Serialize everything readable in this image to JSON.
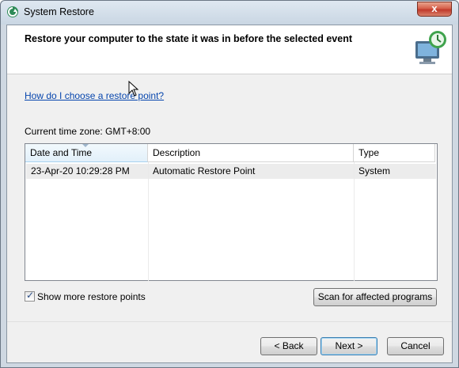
{
  "window": {
    "title": "System Restore",
    "close_symbol": "x"
  },
  "header": {
    "title": "Restore your computer to the state it was in before the selected event"
  },
  "help_link": "How do I choose a restore point?",
  "timezone_label": "Current time zone: GMT+8:00",
  "table": {
    "columns": [
      "Date and Time",
      "Description",
      "Type"
    ],
    "rows": [
      {
        "date": "23-Apr-20 10:29:28 PM",
        "description": "Automatic Restore Point",
        "type": "System"
      }
    ]
  },
  "show_more": {
    "label": "Show more restore points",
    "checked": true
  },
  "buttons": {
    "scan": "Scan for affected programs",
    "back": "< Back",
    "next": "Next >",
    "cancel": "Cancel"
  },
  "colors": {
    "link": "#0645ad",
    "close_button": "#c0392b",
    "selected_row": "#ececec"
  }
}
